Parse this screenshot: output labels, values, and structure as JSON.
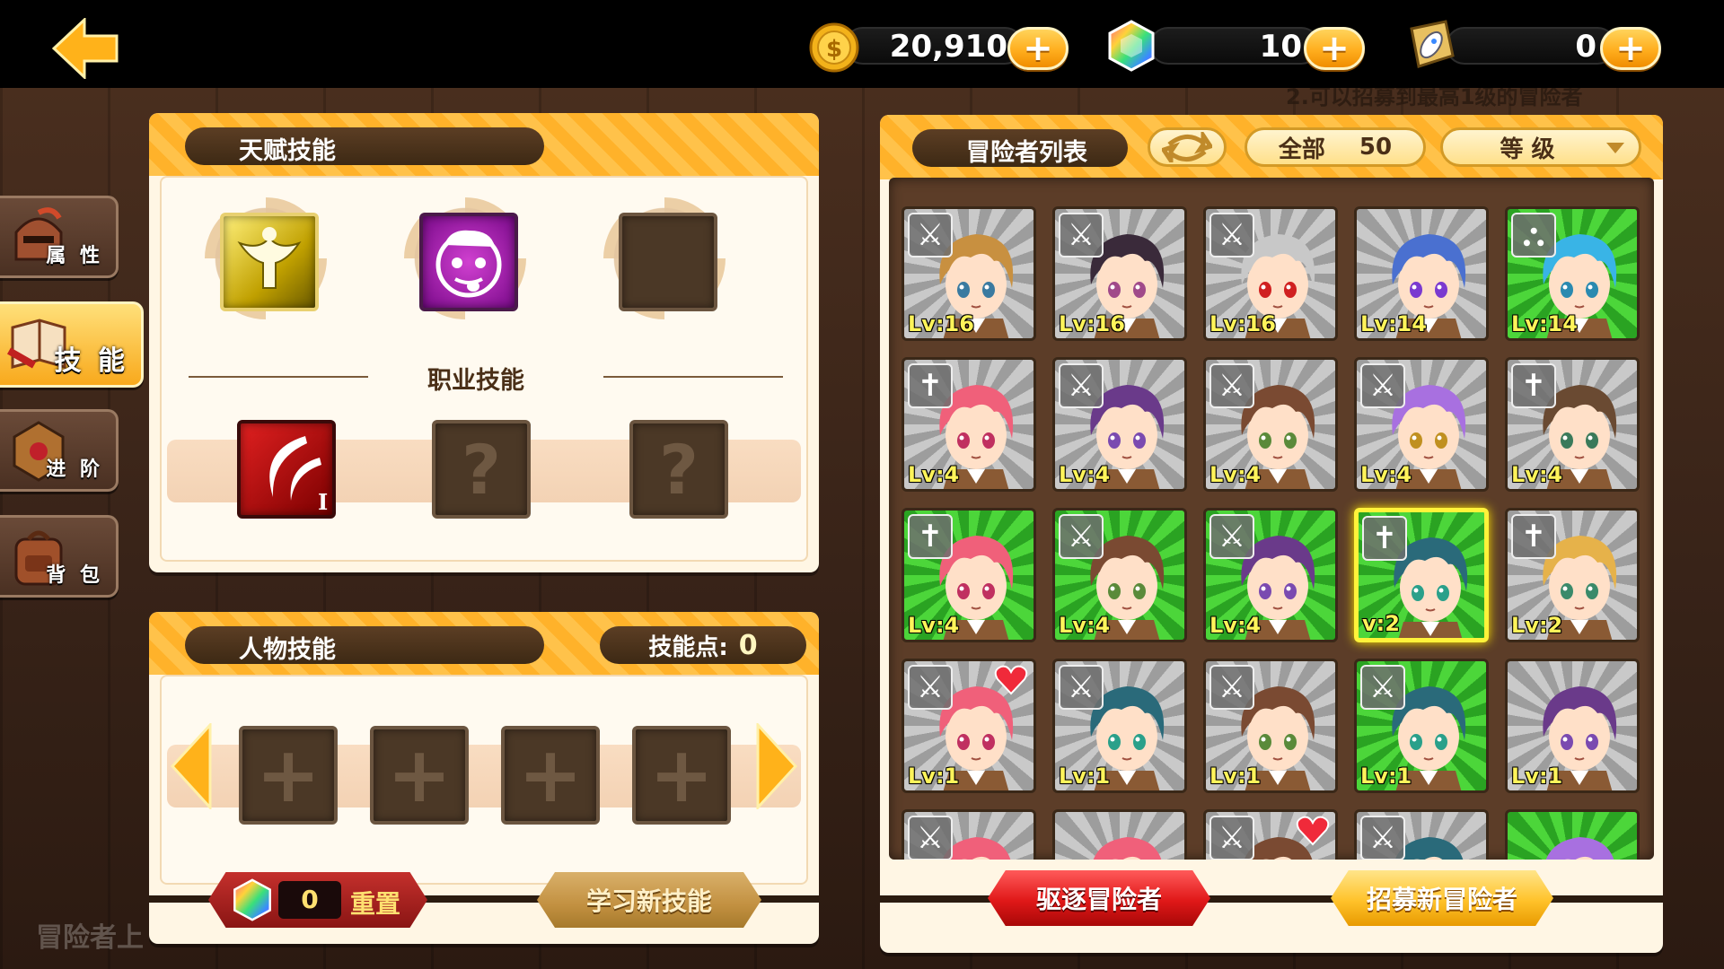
{
  "topbar": {
    "gold": "20,910",
    "gems": "10",
    "tickets": "0",
    "plus": "+"
  },
  "sidebar": {
    "tabs": [
      {
        "label": "属 性",
        "icon": "knight-helmet-icon"
      },
      {
        "label": "技 能",
        "icon": "spellbook-icon"
      },
      {
        "label": "进 阶",
        "icon": "emblem-icon"
      },
      {
        "label": "背 包",
        "icon": "backpack-icon"
      }
    ]
  },
  "background": {
    "caption": "冒险者上",
    "note": "2.可以招募到最高1级的冒险者"
  },
  "talent": {
    "title": "天赋技能",
    "job_title": "职业技能",
    "job_slot_mark": "?",
    "rank_mark": "I"
  },
  "character": {
    "title": "人物技能",
    "points_label": "技能点:",
    "points_value": "0",
    "plus": "+",
    "reset_count": "0",
    "reset_label": "重置",
    "learn_label": "学习新技能"
  },
  "roster": {
    "title": "冒险者列表",
    "filter_all_label": "全部",
    "filter_all_count": "50",
    "sort_label": "等 级",
    "dismiss_label": "驱逐冒险者",
    "recruit_label": "招募新冒险者",
    "heroes": [
      {
        "role": "sword",
        "role_glyph": "⚔",
        "lv": "Lv:16",
        "bg": "gray",
        "hair": "#c89040",
        "eyes": "#3a7aa0"
      },
      {
        "role": "sword",
        "role_glyph": "⚔",
        "lv": "Lv:16",
        "bg": "gray",
        "hair": "#3a2a3a",
        "eyes": "#a04a8a"
      },
      {
        "role": "sword",
        "role_glyph": "⚔",
        "lv": "Lv:16",
        "bg": "gray",
        "hair": "#c8c8c8",
        "eyes": "#d02020"
      },
      {
        "role": "",
        "role_glyph": "",
        "lv": "Lv:14",
        "bg": "gray",
        "hair": "#4a70d0",
        "eyes": "#7a3ad0"
      },
      {
        "role": "bed",
        "role_glyph": "⛬",
        "lv": "Lv:14",
        "bg": "green",
        "hair": "#39b4e6",
        "eyes": "#2a8ab0"
      },
      {
        "role": "cross",
        "role_glyph": "✝",
        "lv": "Lv:4",
        "bg": "gray",
        "hair": "#f0607a",
        "eyes": "#c03060"
      },
      {
        "role": "sword",
        "role_glyph": "⚔",
        "lv": "Lv:4",
        "bg": "gray",
        "hair": "#6a3a8a",
        "eyes": "#7a4ab0"
      },
      {
        "role": "sword",
        "role_glyph": "⚔",
        "lv": "Lv:4",
        "bg": "gray",
        "hair": "#7a4a32",
        "eyes": "#5a8a3a"
      },
      {
        "role": "sword",
        "role_glyph": "⚔",
        "lv": "Lv:4",
        "bg": "gray",
        "hair": "#a870e0",
        "eyes": "#c09020"
      },
      {
        "role": "cross",
        "role_glyph": "✝",
        "lv": "Lv:4",
        "bg": "gray",
        "hair": "#6a4a32",
        "eyes": "#3a7a5a"
      },
      {
        "role": "cross",
        "role_glyph": "✝",
        "lv": "Lv:4",
        "bg": "green",
        "hair": "#f0607a",
        "eyes": "#c03060"
      },
      {
        "role": "sword",
        "role_glyph": "⚔",
        "lv": "Lv:4",
        "bg": "green",
        "hair": "#7a4a32",
        "eyes": "#5a8a3a"
      },
      {
        "role": "sword",
        "role_glyph": "⚔",
        "lv": "Lv:4",
        "bg": "green",
        "hair": "#6a3a8a",
        "eyes": "#7a4ab0"
      },
      {
        "role": "cross",
        "role_glyph": "✝",
        "lv": "v:2",
        "bg": "green",
        "hair": "#2a6a7a",
        "eyes": "#2aa08a",
        "selected": true
      },
      {
        "role": "cross",
        "role_glyph": "✝",
        "lv": "Lv:2",
        "bg": "gray",
        "hair": "#e6b24a",
        "eyes": "#3a8a6a"
      },
      {
        "role": "sword",
        "role_glyph": "⚔",
        "lv": "Lv:1",
        "bg": "gray",
        "hair": "#f0607a",
        "eyes": "#c03060",
        "heart": true
      },
      {
        "role": "sword",
        "role_glyph": "⚔",
        "lv": "Lv:1",
        "bg": "gray",
        "hair": "#2a6a7a",
        "eyes": "#2aa08a"
      },
      {
        "role": "sword",
        "role_glyph": "⚔",
        "lv": "Lv:1",
        "bg": "gray",
        "hair": "#7a4a32",
        "eyes": "#5a8a3a"
      },
      {
        "role": "sword",
        "role_glyph": "⚔",
        "lv": "Lv:1",
        "bg": "green",
        "hair": "#2a6a7a",
        "eyes": "#2aa08a"
      },
      {
        "role": "",
        "role_glyph": "",
        "lv": "Lv:1",
        "bg": "gray",
        "hair": "#6a3a8a",
        "eyes": "#7a4ab0"
      },
      {
        "role": "sword",
        "role_glyph": "⚔",
        "lv": "",
        "bg": "gray",
        "hair": "#f0607a",
        "eyes": "#c03060"
      },
      {
        "role": "",
        "role_glyph": "",
        "lv": "",
        "bg": "gray",
        "hair": "#f0607a",
        "eyes": "#c03060"
      },
      {
        "role": "sword",
        "role_glyph": "⚔",
        "lv": "",
        "bg": "gray",
        "hair": "#7a4a32",
        "eyes": "#5a8a3a",
        "heart": true
      },
      {
        "role": "sword",
        "role_glyph": "⚔",
        "lv": "",
        "bg": "gray",
        "hair": "#2a6a7a",
        "eyes": "#2aa08a"
      },
      {
        "role": "",
        "role_glyph": "",
        "lv": "",
        "bg": "green",
        "hair": "#a870e0",
        "eyes": "#c09020"
      }
    ]
  },
  "colors": {
    "accent": "#ffb22a",
    "panel": "#fff6e4",
    "dark_brown": "#3d2914",
    "level_text": "#fff45a",
    "selected": "#fff33a"
  }
}
